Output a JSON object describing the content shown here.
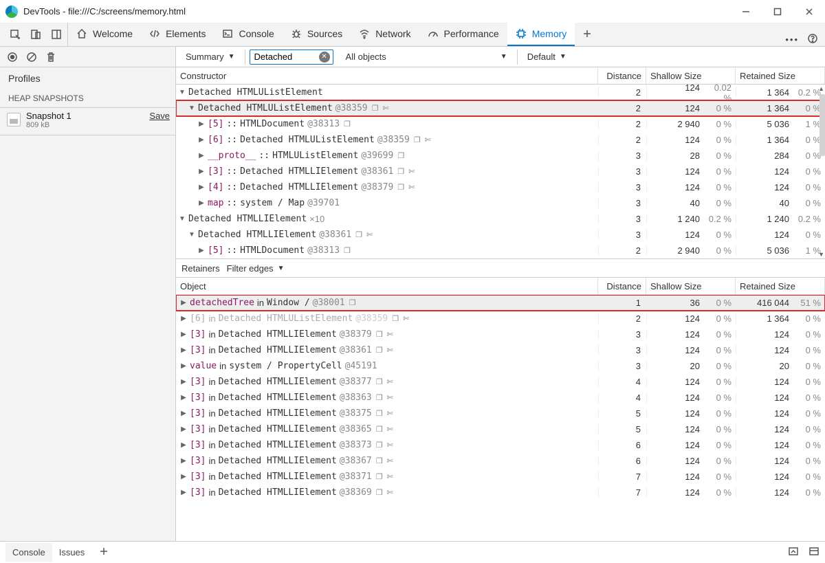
{
  "window": {
    "title": "DevTools - file:///C:/screens/memory.html"
  },
  "tabs": {
    "welcome": "Welcome",
    "elements": "Elements",
    "console": "Console",
    "sources": "Sources",
    "network": "Network",
    "performance": "Performance",
    "memory": "Memory"
  },
  "profiles_label": "Profiles",
  "heap_label": "HEAP SNAPSHOTS",
  "snapshot": {
    "name": "Snapshot 1",
    "size": "809 kB",
    "save": "Save"
  },
  "toolbar": {
    "summary": "Summary",
    "filter": "Detached",
    "allobjects": "All objects",
    "default": "Default"
  },
  "headers": {
    "constructor": "Constructor",
    "object": "Object",
    "distance": "Distance",
    "shallow": "Shallow Size",
    "retained": "Retained Size"
  },
  "retainers": {
    "label": "Retainers",
    "filter": "Filter edges"
  },
  "drawer": {
    "console": "Console",
    "issues": "Issues"
  },
  "top_rows": [
    {
      "t": "down",
      "ind": 0,
      "label": "Detached HTMLUListElement",
      "id": "",
      "d": "2",
      "s": "124",
      "sp": "0.02 %",
      "r": "1 364",
      "rp": "0.2 %"
    },
    {
      "t": "down",
      "ind": 1,
      "label": "Detached HTMLUListElement",
      "id": "@38359",
      "ic": 2,
      "d": "2",
      "s": "124",
      "sp": "0 %",
      "r": "1 364",
      "rp": "0 %",
      "sel": true,
      "box": true
    },
    {
      "t": "right",
      "ind": 2,
      "prop": "[5]",
      "sep": " :: ",
      "label": "HTMLDocument",
      "id": "@38313",
      "ic": 1,
      "d": "2",
      "s": "2 940",
      "sp": "0 %",
      "r": "5 036",
      "rp": "1 %"
    },
    {
      "t": "right",
      "ind": 2,
      "prop": "[6]",
      "sep": " :: ",
      "label": "Detached HTMLUListElement",
      "id": "@38359",
      "ic": 2,
      "d": "2",
      "s": "124",
      "sp": "0 %",
      "r": "1 364",
      "rp": "0 %"
    },
    {
      "t": "right",
      "ind": 2,
      "prop": "__proto__",
      "sep": " :: ",
      "label": "HTMLUListElement",
      "id": "@39699",
      "ic": 1,
      "d": "3",
      "s": "28",
      "sp": "0 %",
      "r": "284",
      "rp": "0 %"
    },
    {
      "t": "right",
      "ind": 2,
      "prop": "[3]",
      "sep": " :: ",
      "label": "Detached HTMLLIElement",
      "id": "@38361",
      "ic": 2,
      "d": "3",
      "s": "124",
      "sp": "0 %",
      "r": "124",
      "rp": "0 %"
    },
    {
      "t": "right",
      "ind": 2,
      "prop": "[4]",
      "sep": " :: ",
      "label": "Detached HTMLLIElement",
      "id": "@38379",
      "ic": 2,
      "d": "3",
      "s": "124",
      "sp": "0 %",
      "r": "124",
      "rp": "0 %"
    },
    {
      "t": "right",
      "ind": 2,
      "prop": "map",
      "sep": " :: ",
      "label": "system / Map",
      "id": "@39701",
      "d": "3",
      "s": "40",
      "sp": "0 %",
      "r": "40",
      "rp": "0 %"
    },
    {
      "t": "down",
      "ind": 0,
      "label": "Detached HTMLLIElement",
      "id": "",
      "count": "×10",
      "d": "3",
      "s": "1 240",
      "sp": "0.2 %",
      "r": "1 240",
      "rp": "0.2 %"
    },
    {
      "t": "down",
      "ind": 1,
      "label": "Detached HTMLLIElement",
      "id": "@38361",
      "ic": 2,
      "d": "3",
      "s": "124",
      "sp": "0 %",
      "r": "124",
      "rp": "0 %"
    },
    {
      "t": "right",
      "ind": 2,
      "prop": "[5]",
      "sep": " :: ",
      "label": "HTMLDocument",
      "id": "@38313",
      "ic": 1,
      "d": "2",
      "s": "2 940",
      "sp": "0 %",
      "r": "5 036",
      "rp": "1 %"
    }
  ],
  "retain_rows": [
    {
      "t": "right",
      "ind": 0,
      "prop": "detachedTree",
      "sep": " in ",
      "label": "Window / ",
      "id": "@38001",
      "ic": 1,
      "d": "1",
      "s": "36",
      "sp": "0 %",
      "r": "416 044",
      "rp": "51 %",
      "sel": true,
      "box": true
    },
    {
      "t": "right",
      "ind": 0,
      "prop": "[6]",
      "sep": " in ",
      "label": "Detached HTMLUListElement",
      "id": "@38359",
      "ic": 2,
      "gray": true,
      "d": "2",
      "s": "124",
      "sp": "0 %",
      "r": "1 364",
      "rp": "0 %"
    },
    {
      "t": "right",
      "ind": 0,
      "prop": "[3]",
      "sep": " in ",
      "label": "Detached HTMLLIElement",
      "id": "@38379",
      "ic": 2,
      "d": "3",
      "s": "124",
      "sp": "0 %",
      "r": "124",
      "rp": "0 %"
    },
    {
      "t": "right",
      "ind": 0,
      "prop": "[3]",
      "sep": " in ",
      "label": "Detached HTMLLIElement",
      "id": "@38361",
      "ic": 2,
      "d": "3",
      "s": "124",
      "sp": "0 %",
      "r": "124",
      "rp": "0 %"
    },
    {
      "t": "right",
      "ind": 0,
      "prop": "value",
      "sep": " in ",
      "label": "system / PropertyCell",
      "id": "@45191",
      "d": "3",
      "s": "20",
      "sp": "0 %",
      "r": "20",
      "rp": "0 %"
    },
    {
      "t": "right",
      "ind": 0,
      "prop": "[3]",
      "sep": " in ",
      "label": "Detached HTMLLIElement",
      "id": "@38377",
      "ic": 2,
      "d": "4",
      "s": "124",
      "sp": "0 %",
      "r": "124",
      "rp": "0 %"
    },
    {
      "t": "right",
      "ind": 0,
      "prop": "[3]",
      "sep": " in ",
      "label": "Detached HTMLLIElement",
      "id": "@38363",
      "ic": 2,
      "d": "4",
      "s": "124",
      "sp": "0 %",
      "r": "124",
      "rp": "0 %"
    },
    {
      "t": "right",
      "ind": 0,
      "prop": "[3]",
      "sep": " in ",
      "label": "Detached HTMLLIElement",
      "id": "@38375",
      "ic": 2,
      "d": "5",
      "s": "124",
      "sp": "0 %",
      "r": "124",
      "rp": "0 %"
    },
    {
      "t": "right",
      "ind": 0,
      "prop": "[3]",
      "sep": " in ",
      "label": "Detached HTMLLIElement",
      "id": "@38365",
      "ic": 2,
      "d": "5",
      "s": "124",
      "sp": "0 %",
      "r": "124",
      "rp": "0 %"
    },
    {
      "t": "right",
      "ind": 0,
      "prop": "[3]",
      "sep": " in ",
      "label": "Detached HTMLLIElement",
      "id": "@38373",
      "ic": 2,
      "d": "6",
      "s": "124",
      "sp": "0 %",
      "r": "124",
      "rp": "0 %"
    },
    {
      "t": "right",
      "ind": 0,
      "prop": "[3]",
      "sep": " in ",
      "label": "Detached HTMLLIElement",
      "id": "@38367",
      "ic": 2,
      "d": "6",
      "s": "124",
      "sp": "0 %",
      "r": "124",
      "rp": "0 %"
    },
    {
      "t": "right",
      "ind": 0,
      "prop": "[3]",
      "sep": " in ",
      "label": "Detached HTMLLIElement",
      "id": "@38371",
      "ic": 2,
      "d": "7",
      "s": "124",
      "sp": "0 %",
      "r": "124",
      "rp": "0 %"
    },
    {
      "t": "right",
      "ind": 0,
      "prop": "[3]",
      "sep": " in ",
      "label": "Detached HTMLLIElement",
      "id": "@38369",
      "ic": 2,
      "d": "7",
      "s": "124",
      "sp": "0 %",
      "r": "124",
      "rp": "0 %"
    }
  ]
}
